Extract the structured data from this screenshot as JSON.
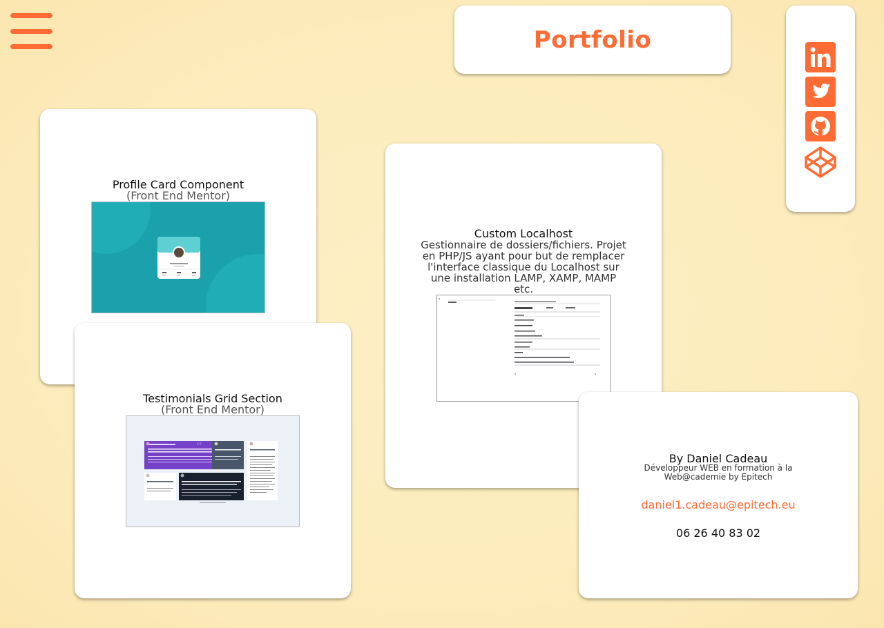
{
  "header": {
    "title": "Portfolio",
    "accent": "#ff6b35"
  },
  "menu": {
    "icon": "hamburger-menu-icon"
  },
  "social": [
    {
      "name": "linkedin",
      "icon": "linkedin-icon"
    },
    {
      "name": "twitter",
      "icon": "twitter-icon"
    },
    {
      "name": "github",
      "icon": "github-icon"
    },
    {
      "name": "codepen",
      "icon": "codepen-icon"
    }
  ],
  "projects": {
    "profile_card": {
      "title": "Profile Card Component",
      "subtitle": "(Front End Mentor)"
    },
    "testimonials": {
      "title": "Testimonials Grid Section",
      "subtitle": "(Front End Mentor)"
    },
    "localhost": {
      "title": "Custom Localhost",
      "description": "Gestionnaire de dossiers/fichiers. Projet en PHP/JS ayant pour but de remplacer l'interface classique du Localhost sur une installation LAMP, XAMP, MAMP etc."
    }
  },
  "contact": {
    "name": "By Daniel Cadeau",
    "role": "Développeur WEB en formation à la Web@cademie by Epitech",
    "email": "daniel1.cadeau@epitech.eu",
    "phone": "06 26 40 83 02"
  }
}
